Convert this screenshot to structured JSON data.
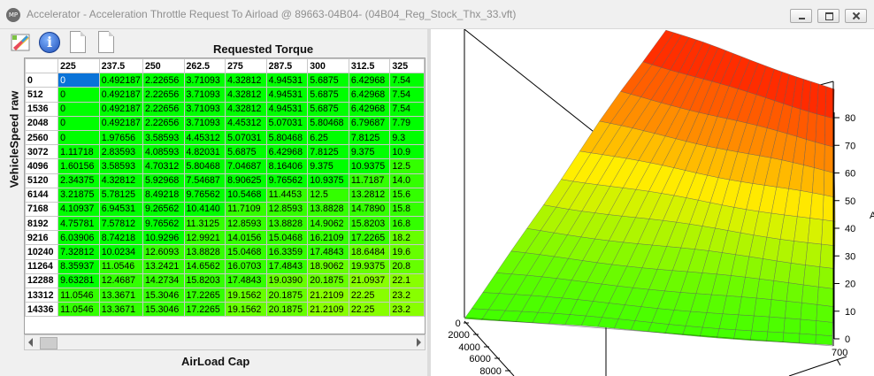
{
  "window": {
    "title": "Accelerator - Acceleration Throttle Request To Airload @ 89663-04B04- (04B04_Reg_Stock_Thx_33.vft)",
    "app_icon_text": "MP"
  },
  "toolbar": {
    "icons": [
      "palette-icon",
      "info-icon",
      "document-icon",
      "document-icon"
    ],
    "info_glyph": "i"
  },
  "table": {
    "x_axis_title": "Requested Torque",
    "y_axis_title": "VehicleSpeed raw",
    "bottom_axis_title": "AirLoad Cap",
    "columns": [
      "225",
      "237.5",
      "250",
      "262.5",
      "275",
      "287.5",
      "300",
      "312.5",
      "325"
    ],
    "rows": [
      {
        "label": "0",
        "values": [
          "0",
          "0.492187",
          "2.22656",
          "3.71093",
          "4.32812",
          "4.94531",
          "5.6875",
          "6.42968",
          "7.54"
        ]
      },
      {
        "label": "512",
        "values": [
          "0",
          "0.492187",
          "2.22656",
          "3.71093",
          "4.32812",
          "4.94531",
          "5.6875",
          "6.42968",
          "7.54"
        ]
      },
      {
        "label": "1536",
        "values": [
          "0",
          "0.492187",
          "2.22656",
          "3.71093",
          "4.32812",
          "4.94531",
          "5.6875",
          "6.42968",
          "7.54"
        ]
      },
      {
        "label": "2048",
        "values": [
          "0",
          "0.492187",
          "2.22656",
          "3.71093",
          "4.45312",
          "5.07031",
          "5.80468",
          "6.79687",
          "7.79"
        ]
      },
      {
        "label": "2560",
        "values": [
          "0",
          "1.97656",
          "3.58593",
          "4.45312",
          "5.07031",
          "5.80468",
          "6.25",
          "7.8125",
          "9.3"
        ]
      },
      {
        "label": "3072",
        "values": [
          "1.11718",
          "2.83593",
          "4.08593",
          "4.82031",
          "5.6875",
          "6.42968",
          "7.8125",
          "9.375",
          "10.9"
        ]
      },
      {
        "label": "4096",
        "values": [
          "1.60156",
          "3.58593",
          "4.70312",
          "5.80468",
          "7.04687",
          "8.16406",
          "9.375",
          "10.9375",
          "12.5"
        ]
      },
      {
        "label": "5120",
        "values": [
          "2.34375",
          "4.32812",
          "5.92968",
          "7.54687",
          "8.90625",
          "9.76562",
          "10.9375",
          "11.7187",
          "14.0"
        ]
      },
      {
        "label": "6144",
        "values": [
          "3.21875",
          "5.78125",
          "8.49218",
          "9.76562",
          "10.5468",
          "11.4453",
          "12.5",
          "13.2812",
          "15.6"
        ]
      },
      {
        "label": "7168",
        "values": [
          "4.10937",
          "6.94531",
          "9.26562",
          "10.4140",
          "11.7109",
          "12.8593",
          "13.8828",
          "14.7890",
          "15.8"
        ]
      },
      {
        "label": "8192",
        "values": [
          "4.75781",
          "7.57812",
          "9.76562",
          "11.3125",
          "12.8593",
          "13.8828",
          "14.9062",
          "15.8203",
          "16.8"
        ]
      },
      {
        "label": "9216",
        "values": [
          "6.03906",
          "8.74218",
          "10.9296",
          "12.9921",
          "14.0156",
          "15.0468",
          "16.2109",
          "17.2265",
          "18.2"
        ]
      },
      {
        "label": "10240",
        "values": [
          "7.32812",
          "10.0234",
          "12.6093",
          "13.8828",
          "15.0468",
          "16.3359",
          "17.4843",
          "18.6484",
          "19.6"
        ]
      },
      {
        "label": "11264",
        "values": [
          "8.35937",
          "11.0546",
          "13.2421",
          "14.6562",
          "16.0703",
          "17.4843",
          "18.9062",
          "19.9375",
          "20.8"
        ]
      },
      {
        "label": "12288",
        "values": [
          "9.63281",
          "12.4687",
          "14.2734",
          "15.8203",
          "17.4843",
          "19.0390",
          "20.1875",
          "21.0937",
          "22.1"
        ]
      },
      {
        "label": "13312",
        "values": [
          "11.0546",
          "13.3671",
          "15.3046",
          "17.2265",
          "19.1562",
          "20.1875",
          "21.2109",
          "22.25",
          "23.2"
        ]
      },
      {
        "label": "14336",
        "values": [
          "11.0546",
          "13.3671",
          "15.3046",
          "17.2265",
          "19.1562",
          "20.1875",
          "21.2109",
          "22.25",
          "23.2"
        ]
      }
    ],
    "selected_cell": {
      "row": 0,
      "col": 0
    }
  },
  "plot3d": {
    "z_ticks": [
      "0",
      "10",
      "20",
      "30",
      "40",
      "50",
      "60",
      "70",
      "80"
    ],
    "left_ticks": [
      "0",
      "2000",
      "4000",
      "6000",
      "8000"
    ],
    "bottom_right_tick": "700",
    "partial_axis_label": "A",
    "colors": {
      "low": "#44ff00",
      "mid": "#ffee00",
      "high": "#ff0000",
      "mesh": "#5a5a5a"
    }
  }
}
